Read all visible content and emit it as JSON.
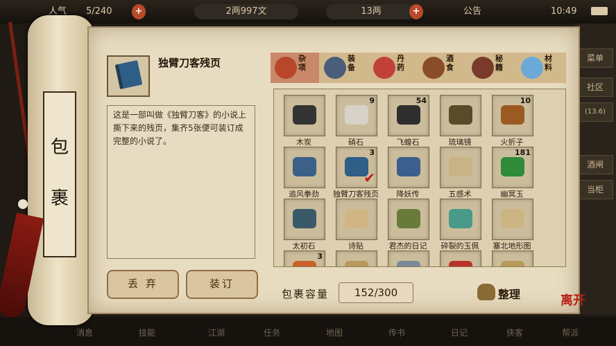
{
  "topbar": {
    "reputation_label": "人气",
    "reputation_value": "5/240",
    "money_value": "2两997文",
    "silver_value": "13两",
    "notice_label": "公告",
    "time": "10:49"
  },
  "right_menu": [
    "菜单",
    "社区",
    "(13.6)",
    "酒闸",
    "当柜"
  ],
  "bottom_menu": [
    "消息",
    "技能",
    "江湖",
    "任务",
    "地图",
    "传书",
    "日记",
    "侠客",
    "帮派"
  ],
  "scroll": {
    "title_char_1": "包",
    "title_char_2": "裹"
  },
  "detail": {
    "item_name": "独臂刀客残页",
    "description": "这是一部叫做《独臂刀客》的小说上撕下来的残页，集齐5张便可装订成完整的小说了。",
    "discard_label": "丢 弃",
    "bind_label": "装订"
  },
  "tabs": [
    {
      "label": "杂项",
      "color": "#b8462a",
      "active": true
    },
    {
      "label": "装备",
      "color": "#4a5d7a",
      "active": false
    },
    {
      "label": "丹药",
      "color": "#c2403a",
      "active": false
    },
    {
      "label": "酒食",
      "color": "#8a4d2a",
      "active": false
    },
    {
      "label": "秘籍",
      "color": "#7a3a2a",
      "active": false
    },
    {
      "label": "材料",
      "color": "#6aa9d8",
      "active": false
    }
  ],
  "items": [
    {
      "name": "木炭",
      "count": "",
      "color": "#333333",
      "checked": false
    },
    {
      "name": "硝石",
      "count": "9",
      "color": "#d6d2c8",
      "checked": false
    },
    {
      "name": "飞蝗石",
      "count": "54",
      "color": "#2e2e2e",
      "checked": false
    },
    {
      "name": "琉璃镜",
      "count": "",
      "color": "#5b4a2a",
      "checked": false
    },
    {
      "name": "火折子",
      "count": "10",
      "color": "#9a5a22",
      "checked": false
    },
    {
      "name": "追风拳劲",
      "count": "",
      "color": "#3c6189",
      "checked": false
    },
    {
      "name": "独臂刀客残页",
      "count": "3",
      "color": "#2f5e86",
      "checked": true
    },
    {
      "name": "降妖传",
      "count": "",
      "color": "#3c5f8d",
      "checked": false
    },
    {
      "name": "五感术",
      "count": "",
      "color": "#c9b285",
      "checked": false
    },
    {
      "name": "幽冥玉",
      "count": "181",
      "color": "#2f8a3a",
      "checked": false
    },
    {
      "name": "太初石",
      "count": "",
      "color": "#3a5a6a",
      "checked": false
    },
    {
      "name": "诗贴",
      "count": "",
      "color": "#d1b683",
      "checked": false
    },
    {
      "name": "君杰的日记",
      "count": "",
      "color": "#6a7a3a",
      "checked": false
    },
    {
      "name": "碎裂的玉佩",
      "count": "",
      "color": "#4a9a8a",
      "checked": false
    },
    {
      "name": "塞北地形图",
      "count": "",
      "color": "#cbb583",
      "checked": false
    },
    {
      "name": "",
      "count": "3",
      "color": "#c9622a",
      "checked": false
    },
    {
      "name": "",
      "count": "",
      "color": "#b59a5a",
      "checked": false
    },
    {
      "name": "",
      "count": "",
      "color": "#7a8a9a",
      "checked": false
    },
    {
      "name": "",
      "count": "",
      "color": "#b8332a",
      "checked": false
    },
    {
      "name": "",
      "count": "",
      "color": "#b59a5a",
      "checked": false
    }
  ],
  "capacity": {
    "label": "包裹容量",
    "value": "152/300"
  },
  "sort_label": "整理",
  "exit_label": "离开"
}
